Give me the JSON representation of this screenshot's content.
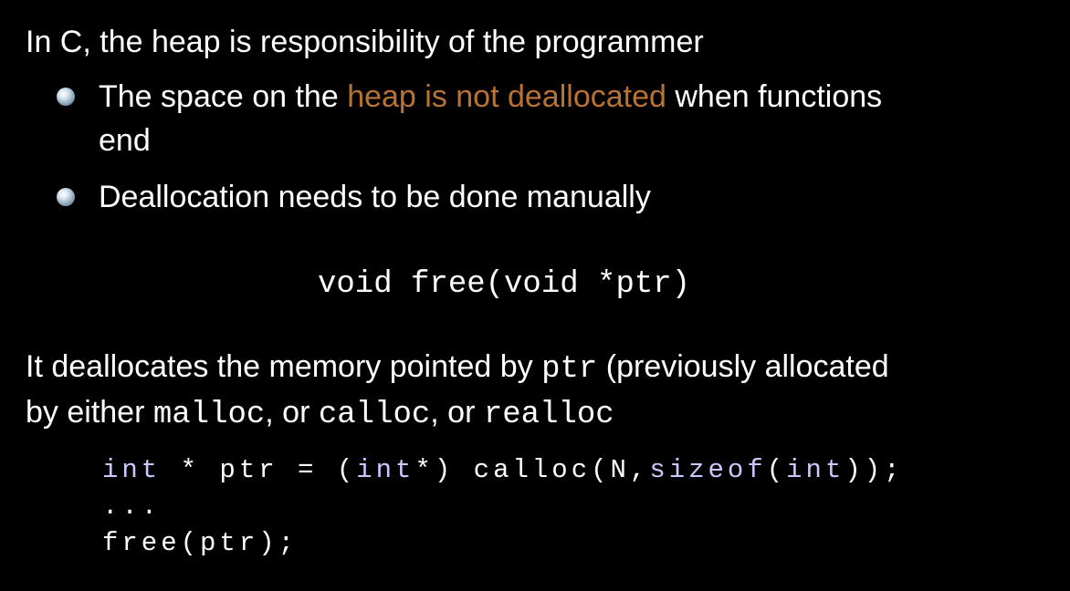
{
  "heading": "In C, the heap is responsibility of the programmer",
  "bullets": [
    {
      "pre": "The space on the ",
      "highlight": "heap is not deallocated",
      "post": " when functions",
      "cont": "end"
    },
    {
      "text": "Deallocation needs to be done manually"
    }
  ],
  "signature": "void free(void *ptr)",
  "explanation": {
    "l1_pre": "It deallocates the memory pointed by ",
    "l1_code": "ptr",
    "l1_post": " (previously allocated",
    "l2_pre": "by either ",
    "l2_code1": "malloc",
    "l2_sep1": ", or ",
    "l2_code2": "calloc",
    "l2_sep2": ", or ",
    "l2_code3": "realloc"
  },
  "code": {
    "l1_kw1": "int",
    "l1_a": " * ptr = (",
    "l1_kw2": "int",
    "l1_b": "*) calloc(N,",
    "l1_kw3": "sizeof",
    "l1_c": "(",
    "l1_kw4": "int",
    "l1_d": "));",
    "l2": "...",
    "l3": "free(ptr);"
  },
  "colors": {
    "background": "#000000",
    "text": "#ffffff",
    "accent": "#b87333",
    "keyword": "#c9c9ff"
  }
}
